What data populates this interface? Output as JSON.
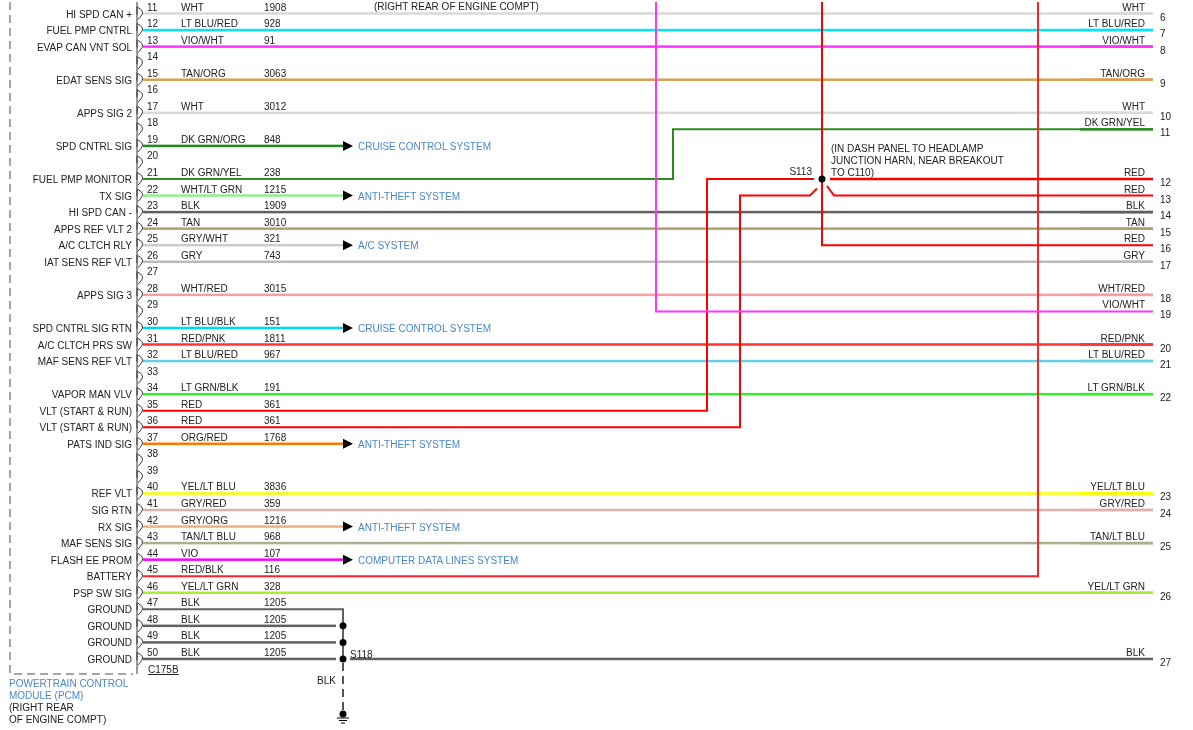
{
  "top_note": "(RIGHT REAR OF ENGINE COMPT)",
  "pins": [
    {
      "pin": "11",
      "label": "HI SPD CAN +",
      "wire": "WHT",
      "circuit": "1908",
      "color": "#d9d9d9"
    },
    {
      "pin": "12",
      "label": "FUEL PMP CNTRL",
      "wire": "LT BLU/RED",
      "circuit": "928",
      "color": "#00e5ff"
    },
    {
      "pin": "13",
      "label": "EVAP CAN VNT SOL",
      "wire": "VIO/WHT",
      "circuit": "91",
      "color": "#ff33ff"
    },
    {
      "pin": "14"
    },
    {
      "pin": "15",
      "label": "EDAT SENS SIG",
      "wire": "TAN/ORG",
      "circuit": "3063",
      "color": "#d8a050"
    },
    {
      "pin": "16"
    },
    {
      "pin": "17",
      "label": "APPS SIG 2",
      "wire": "WHT",
      "circuit": "3012",
      "color": "#d9d9d9"
    },
    {
      "pin": "18"
    },
    {
      "pin": "19",
      "label": "SPD CNTRL SIG",
      "wire": "DK GRN/ORG",
      "circuit": "848",
      "color": "#1f8a1f",
      "destination": "CRUISE CONTROL SYSTEM"
    },
    {
      "pin": "20"
    },
    {
      "pin": "21",
      "label": "FUEL PMP MONITOR",
      "wire": "DK GRN/YEL",
      "circuit": "238",
      "color": "#2e8b22"
    },
    {
      "pin": "22",
      "label": "TX SIG",
      "wire": "WHT/LT GRN",
      "circuit": "1215",
      "color": "#90ee90",
      "destination": "ANTI-THEFT SYSTEM"
    },
    {
      "pin": "23",
      "label": "HI SPD CAN -",
      "wire": "BLK",
      "circuit": "1909",
      "color": "#606060"
    },
    {
      "pin": "24",
      "label": "APPS REF VLT 2",
      "wire": "TAN",
      "circuit": "3010",
      "color": "#b0a070"
    },
    {
      "pin": "25",
      "label": "A/C CLTCH RLY",
      "wire": "GRY/WHT",
      "circuit": "321",
      "color": "#cccccc",
      "destination": "A/C SYSTEM"
    },
    {
      "pin": "26",
      "label": "IAT SENS REF VLT",
      "wire": "GRY",
      "circuit": "743",
      "color": "#bbbbbb"
    },
    {
      "pin": "27"
    },
    {
      "pin": "28",
      "label": "APPS SIG 3",
      "wire": "WHT/RED",
      "circuit": "3015",
      "color": "#f5a0a0"
    },
    {
      "pin": "29"
    },
    {
      "pin": "30",
      "label": "SPD CNTRL SIG RTN",
      "wire": "LT BLU/BLK",
      "circuit": "151",
      "color": "#00d8f0",
      "destination": "CRUISE CONTROL SYSTEM"
    },
    {
      "pin": "31",
      "label": "A/C CLTCH PRS SW",
      "wire": "RED/PNK",
      "circuit": "1811",
      "color": "#ff3333"
    },
    {
      "pin": "32",
      "label": "MAF SENS REF VLT",
      "wire": "LT BLU/RED",
      "circuit": "967",
      "color": "#66d0e0"
    },
    {
      "pin": "33"
    },
    {
      "pin": "34",
      "label": "VAPOR MAN VLV",
      "wire": "LT GRN/BLK",
      "circuit": "191",
      "color": "#33ee33"
    },
    {
      "pin": "35",
      "label": "VLT (START & RUN)",
      "wire": "RED",
      "circuit": "361",
      "color": "#ff0000"
    },
    {
      "pin": "36",
      "label": "VLT (START & RUN)",
      "wire": "RED",
      "circuit": "361",
      "color": "#ff0000"
    },
    {
      "pin": "37",
      "label": "PATS IND SIG",
      "wire": "ORG/RED",
      "circuit": "1768",
      "color": "#ff7700",
      "destination": "ANTI-THEFT SYSTEM"
    },
    {
      "pin": "38"
    },
    {
      "pin": "39"
    },
    {
      "pin": "40",
      "label": "REF VLT",
      "wire": "YEL/LT BLU",
      "circuit": "3836",
      "color": "#ffff00"
    },
    {
      "pin": "41",
      "label": "SIG RTN",
      "wire": "GRY/RED",
      "circuit": "359",
      "color": "#e0b0b0"
    },
    {
      "pin": "42",
      "label": "RX SIG",
      "wire": "GRY/ORG",
      "circuit": "1216",
      "color": "#f0b080",
      "destination": "ANTI-THEFT SYSTEM"
    },
    {
      "pin": "43",
      "label": "MAF SENS SIG",
      "wire": "TAN/LT BLU",
      "circuit": "968",
      "color": "#a8b090"
    },
    {
      "pin": "44",
      "label": "FLASH EE PROM",
      "wire": "VIO",
      "circuit": "107",
      "color": "#ff00ff",
      "destination": "COMPUTER DATA LINES SYSTEM"
    },
    {
      "pin": "45",
      "label": "BATTERY",
      "wire": "RED/BLK",
      "circuit": "116",
      "color": "#ff2222"
    },
    {
      "pin": "46",
      "label": "PSP SW SIG",
      "wire": "YEL/LT GRN",
      "circuit": "328",
      "color": "#aaee33"
    },
    {
      "pin": "47",
      "label": "GROUND",
      "wire": "BLK",
      "circuit": "1205",
      "color": "#606060"
    },
    {
      "pin": "48",
      "label": "GROUND",
      "wire": "BLK",
      "circuit": "1205",
      "color": "#606060"
    },
    {
      "pin": "49",
      "label": "GROUND",
      "wire": "BLK",
      "circuit": "1205",
      "color": "#606060"
    },
    {
      "pin": "50",
      "label": "GROUND",
      "wire": "BLK",
      "circuit": "1205",
      "color": "#606060"
    }
  ],
  "right_pins": [
    {
      "pin": "6",
      "wire": "WHT",
      "color": "#d9d9d9"
    },
    {
      "pin": "7",
      "wire": "LT BLU/RED",
      "color": "#00e5ff"
    },
    {
      "pin": "8",
      "wire": "VIO/WHT",
      "color": "#ff33ff"
    },
    {
      "pin": "9",
      "wire": "TAN/ORG",
      "color": "#d8a050"
    },
    {
      "pin": "10",
      "wire": "WHT",
      "color": "#d9d9d9"
    },
    {
      "pin": "11",
      "wire": "DK GRN/YEL",
      "color": "#2e8b22"
    },
    {
      "pin": "12",
      "wire": "RED",
      "color": "#ff0000"
    },
    {
      "pin": "13",
      "wire": "RED",
      "color": "#ff0000"
    },
    {
      "pin": "14",
      "wire": "BLK",
      "color": "#606060"
    },
    {
      "pin": "15",
      "wire": "TAN",
      "color": "#b0a070"
    },
    {
      "pin": "16",
      "wire": "RED",
      "color": "#ff0000"
    },
    {
      "pin": "17",
      "wire": "GRY",
      "color": "#bbbbbb"
    },
    {
      "pin": "18",
      "wire": "WHT/RED",
      "color": "#f5a0a0"
    },
    {
      "pin": "19",
      "wire": "VIO/WHT",
      "color": "#ff33ff"
    },
    {
      "pin": "20",
      "wire": "RED/PNK",
      "color": "#ff3333"
    },
    {
      "pin": "21",
      "wire": "LT BLU/RED",
      "color": "#66d0e0"
    },
    {
      "pin": "22",
      "wire": "LT GRN/BLK",
      "color": "#33ee33"
    },
    {
      "pin": "23",
      "wire": "YEL/LT BLU",
      "color": "#ffff00"
    },
    {
      "pin": "24",
      "wire": "GRY/RED",
      "color": "#e0b0b0"
    },
    {
      "pin": "25",
      "wire": "TAN/LT BLU",
      "color": "#a8b090"
    },
    {
      "pin": "26",
      "wire": "YEL/LT GRN",
      "color": "#aaee33"
    },
    {
      "pin": "27",
      "wire": "BLK",
      "color": "#606060"
    }
  ],
  "splices": [
    {
      "name": "S113",
      "note": [
        "(IN DASH PANEL TO HEADLAMP",
        "JUNCTION HARN, NEAR BREAKOUT",
        "TO C110)"
      ]
    },
    {
      "name": "S118",
      "wire": "BLK"
    }
  ],
  "connector": "C175B",
  "module": {
    "name": [
      "POWERTRAIN CONTROL",
      "MODULE (PCM)"
    ],
    "location": [
      "(RIGHT REAR",
      "OF ENGINE COMPT)"
    ]
  }
}
